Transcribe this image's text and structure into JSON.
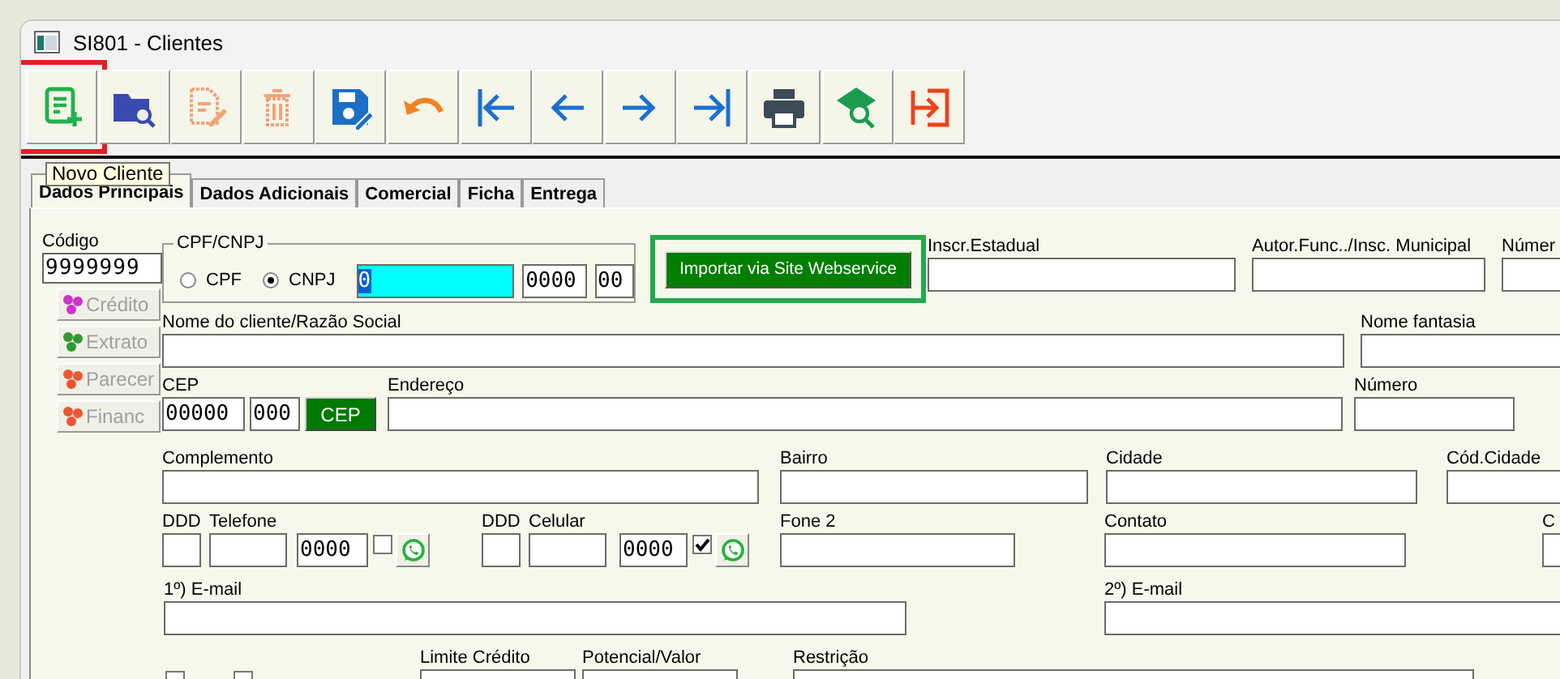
{
  "window": {
    "title": "SI801 - Clientes"
  },
  "toolbar": [
    {
      "kind": "new",
      "disabled": false,
      "highlighted": true
    },
    {
      "kind": "open",
      "disabled": false,
      "highlighted": false
    },
    {
      "kind": "edit",
      "disabled": true,
      "highlighted": false
    },
    {
      "kind": "delete",
      "disabled": true,
      "highlighted": false
    },
    {
      "kind": "save",
      "disabled": false,
      "highlighted": false
    },
    {
      "kind": "undo",
      "disabled": false,
      "highlighted": false
    },
    {
      "kind": "first",
      "disabled": false,
      "highlighted": false
    },
    {
      "kind": "prev",
      "disabled": false,
      "highlighted": false
    },
    {
      "kind": "next",
      "disabled": false,
      "highlighted": false
    },
    {
      "kind": "last",
      "disabled": false,
      "highlighted": false
    },
    {
      "kind": "print",
      "disabled": false,
      "highlighted": false
    },
    {
      "kind": "find",
      "disabled": false,
      "highlighted": false
    },
    {
      "kind": "exit",
      "disabled": false,
      "highlighted": false
    }
  ],
  "tooltip": "Novo Cliente",
  "tabs": [
    {
      "label": "Dados Principais",
      "selected": true
    },
    {
      "label": "Dados Adicionais",
      "selected": false
    },
    {
      "label": "Comercial",
      "selected": false
    },
    {
      "label": "Ficha",
      "selected": false
    },
    {
      "label": "Entrega",
      "selected": false
    }
  ],
  "form": {
    "codigo": {
      "label": "Código",
      "value": "9999999"
    },
    "side_buttons": [
      {
        "label": "Crédito",
        "disabled": true,
        "color": "#cc33cc"
      },
      {
        "label": "Extrato",
        "disabled": true,
        "color": "#339933"
      },
      {
        "label": "Parecer",
        "disabled": true,
        "color": "#ee5533"
      },
      {
        "label": "Financ",
        "disabled": true,
        "color": "#ee5533"
      }
    ],
    "field_lines": [
      [
        {
          "kind": "cpf_group",
          "legend": "CPF/CNPJ",
          "options": [
            {
              "label": "CPF",
              "selected": false
            },
            {
              "label": "CNPJ",
              "selected": true
            }
          ],
          "fields": [
            "0",
            "0000",
            "00"
          ]
        },
        {
          "kind": "import_button",
          "label": "Importar via Site Webservice",
          "highlighted": true
        },
        {
          "kind": "field",
          "label": "Inscr.Estadual"
        },
        {
          "kind": "field",
          "label": "Autor.Func../Insc. Municipal"
        },
        {
          "kind": "field",
          "label": "Númer"
        }
      ],
      [
        {
          "kind": "field",
          "label": "Nome do cliente/Razão Social"
        },
        {
          "kind": "field",
          "label": "Nome fantasia"
        }
      ],
      [
        {
          "kind": "field",
          "label": "CEP",
          "value": "00000"
        },
        {
          "kind": "field",
          "value": "000"
        },
        {
          "kind": "button",
          "label": "CEP"
        },
        {
          "kind": "field",
          "label": "Endereço"
        },
        {
          "kind": "field",
          "label": "Número"
        }
      ],
      [
        {
          "kind": "field",
          "label": "Complemento"
        },
        {
          "kind": "field",
          "label": "Bairro"
        },
        {
          "kind": "field",
          "label": "Cidade"
        },
        {
          "kind": "field",
          "label": "Cód.Cidade"
        }
      ],
      [
        {
          "kind": "field",
          "label": "DDD"
        },
        {
          "kind": "field",
          "label": "Telefone"
        },
        {
          "kind": "field",
          "value": "0000"
        },
        {
          "kind": "checkbox",
          "checked": false
        },
        {
          "kind": "whatsapp"
        },
        {
          "kind": "field",
          "label": "DDD"
        },
        {
          "kind": "field",
          "label": "Celular"
        },
        {
          "kind": "field",
          "value": "0000"
        },
        {
          "kind": "checkbox",
          "checked": true
        },
        {
          "kind": "whatsapp"
        },
        {
          "kind": "field",
          "label": "Fone 2"
        },
        {
          "kind": "field",
          "label": "Contato"
        },
        {
          "kind": "field",
          "label": "C"
        }
      ],
      [
        {
          "kind": "field",
          "label": "1º) E-mail"
        },
        {
          "kind": "field",
          "label": "2º) E-mail"
        }
      ],
      [
        {
          "kind": "checkbox",
          "checked": false
        },
        {
          "kind": "checkbox",
          "checked": false
        },
        {
          "kind": "field",
          "label": "Limite Crédito"
        },
        {
          "kind": "field",
          "label": "Potencial/Valor"
        },
        {
          "kind": "field",
          "label": "Restrição"
        }
      ]
    ]
  }
}
